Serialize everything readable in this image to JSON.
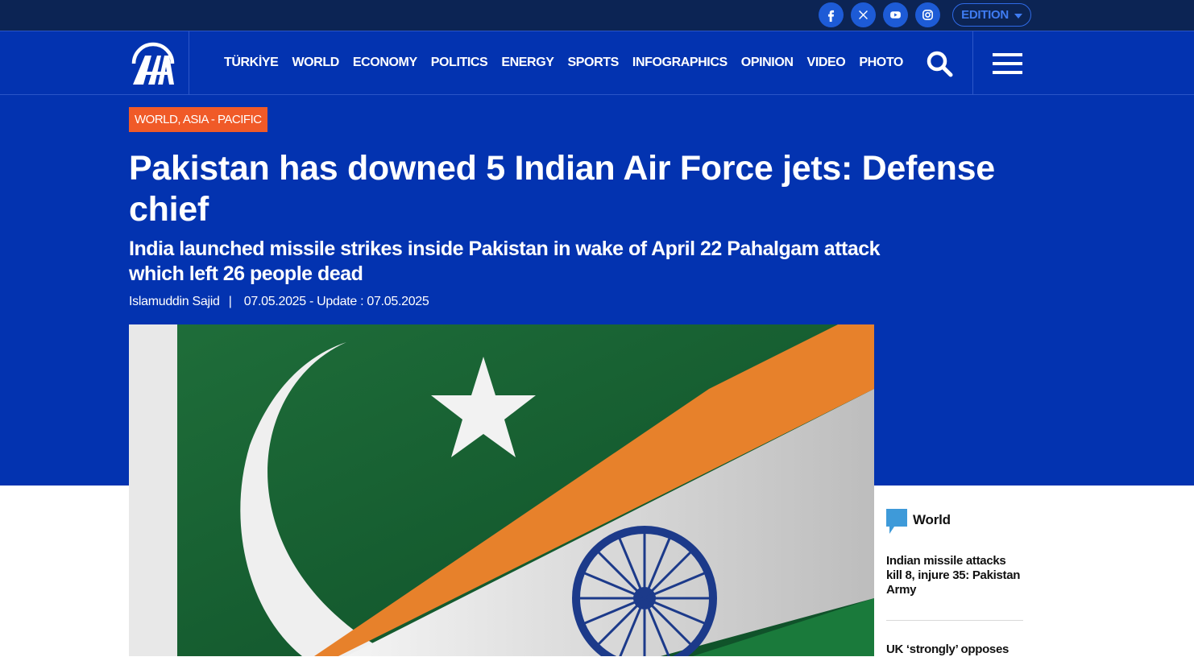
{
  "header": {
    "social": [
      {
        "name": "facebook-icon"
      },
      {
        "name": "x-icon"
      },
      {
        "name": "youtube-icon"
      },
      {
        "name": "instagram-icon"
      }
    ],
    "edition_label": "EDITION"
  },
  "nav": {
    "logo": "AA",
    "items": [
      "TÜRKİYE",
      "WORLD",
      "ECONOMY",
      "POLITICS",
      "ENERGY",
      "SPORTS",
      "INFOGRAPHICS",
      "OPINION",
      "VIDEO",
      "PHOTO"
    ]
  },
  "article": {
    "category": "WORLD, ASIA - PACIFIC",
    "title": "Pakistan has downed 5 Indian Air Force jets: Defense chief",
    "subtitle": "India launched missile strikes inside Pakistan in wake of April 22 Pahalgam attack which left 26 people dead",
    "author": "Islamuddin Sajid",
    "byline_separator": "|",
    "date_text": "07.05.2025 - Update : 07.05.2025"
  },
  "sidebar": {
    "category": "World",
    "items": [
      "Indian missile attacks kill 8, injure 35: Pakistan Army",
      "UK ‘strongly’ opposes"
    ]
  },
  "colors": {
    "top_bar": "#0c2454",
    "primary_blue": "#0333b0",
    "accent_orange": "#f05a28",
    "social_blue": "#1d5bd6"
  }
}
